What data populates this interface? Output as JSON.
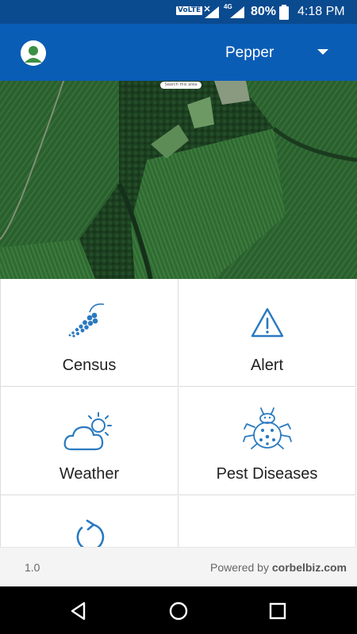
{
  "status_bar": {
    "volte": "VoLTE",
    "network": "4G",
    "battery_percent": "80%",
    "time": "4:18 PM",
    "icons": [
      "signal-icon",
      "battery-icon"
    ]
  },
  "app_bar": {
    "avatar_icon": "user-avatar-icon",
    "selected_crop": "Pepper",
    "dropdown_icon": "caret-down-icon",
    "color": "#0a5db5"
  },
  "map": {
    "search_placeholder": "Search this area"
  },
  "menu": [
    {
      "label": "Census",
      "icon": "pepper-berries-icon"
    },
    {
      "label": "Alert",
      "icon": "warning-triangle-icon"
    },
    {
      "label": "Weather",
      "icon": "cloud-sun-icon"
    },
    {
      "label": "Pest Diseases",
      "icon": "bug-icon"
    },
    {
      "label": "",
      "icon": "refresh-icon"
    }
  ],
  "footer": {
    "version": "1.0",
    "powered_prefix": "Powered by ",
    "powered_brand": "corbelbiz.com"
  },
  "nav_bar": {
    "icons": [
      "back-icon",
      "home-icon",
      "recent-apps-icon"
    ]
  },
  "colors": {
    "icon_blue": "#2a7ac0",
    "status_bar": "#0a4a8f"
  }
}
